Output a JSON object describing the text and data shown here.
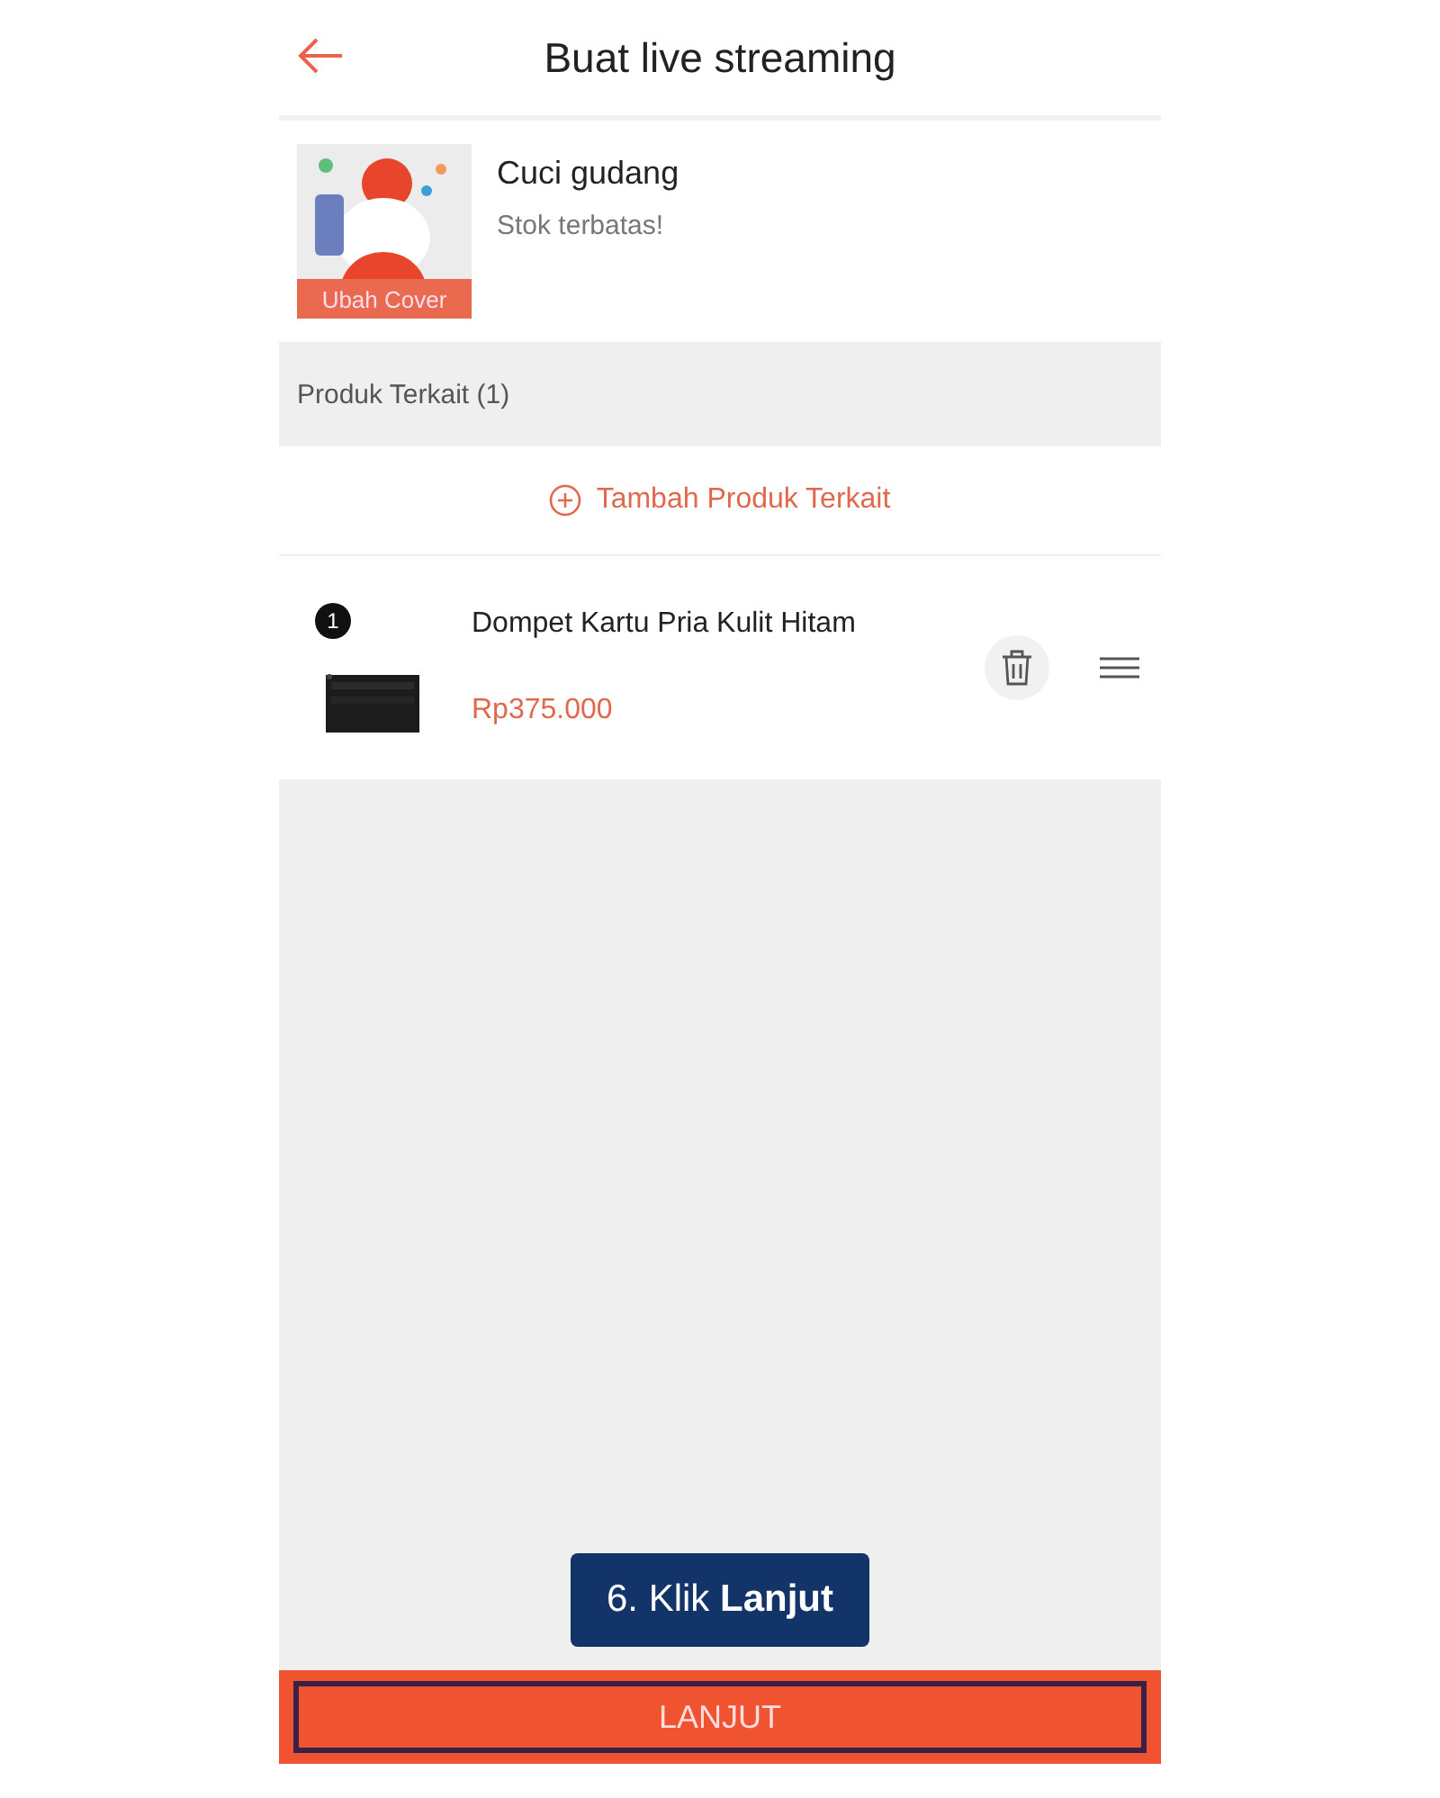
{
  "header": {
    "title": "Buat live streaming"
  },
  "stream": {
    "cover_label": "Ubah Cover",
    "title": "Cuci gudang",
    "subtitle": "Stok terbatas!"
  },
  "related": {
    "heading": "Produk Terkait (1)",
    "add_button": "Tambah Produk Terkait",
    "products": [
      {
        "number": "1",
        "name": "Dompet Kartu Pria Kulit Hitam",
        "price": "Rp375.000"
      }
    ]
  },
  "callout": {
    "text": "6. Klik **Lanjut**"
  },
  "footer": {
    "button": "LANJUT",
    "highlighted": true
  }
}
